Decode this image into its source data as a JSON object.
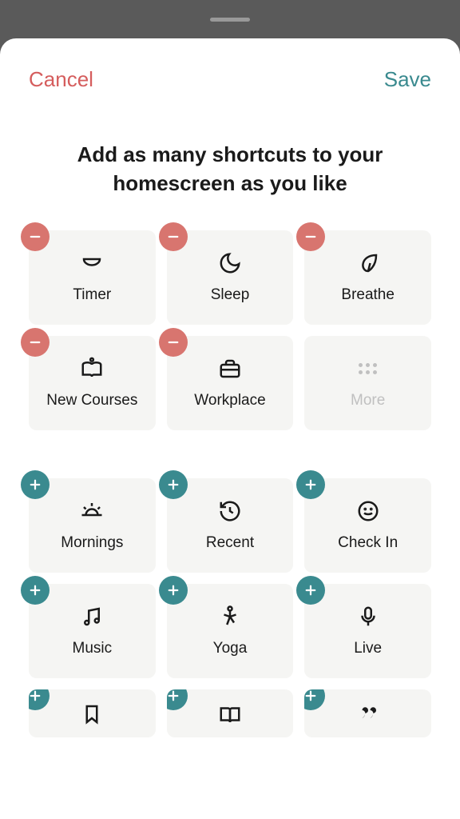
{
  "header": {
    "cancel": "Cancel",
    "save": "Save"
  },
  "title": "Add as many shortcuts to your homescreen as you like",
  "selected": [
    {
      "label": "Timer",
      "icon": "timer"
    },
    {
      "label": "Sleep",
      "icon": "moon"
    },
    {
      "label": "Breathe",
      "icon": "leaf"
    },
    {
      "label": "New Courses",
      "icon": "book-open"
    },
    {
      "label": "Workplace",
      "icon": "briefcase"
    },
    {
      "label": "More",
      "icon": "dots",
      "placeholder": true
    }
  ],
  "available": [
    {
      "label": "Mornings",
      "icon": "sunrise"
    },
    {
      "label": "Recent",
      "icon": "history"
    },
    {
      "label": "Check In",
      "icon": "smile"
    },
    {
      "label": "Music",
      "icon": "music"
    },
    {
      "label": "Yoga",
      "icon": "yoga"
    },
    {
      "label": "Live",
      "icon": "mic"
    },
    {
      "label": "",
      "icon": "bookmark"
    },
    {
      "label": "",
      "icon": "book"
    },
    {
      "label": "",
      "icon": "quote"
    }
  ],
  "colors": {
    "cancel": "#d55d5d",
    "save": "#3a8a8f",
    "remove_badge": "#d8756f",
    "add_badge": "#3a8a8f",
    "tile_bg": "#f5f5f3"
  }
}
